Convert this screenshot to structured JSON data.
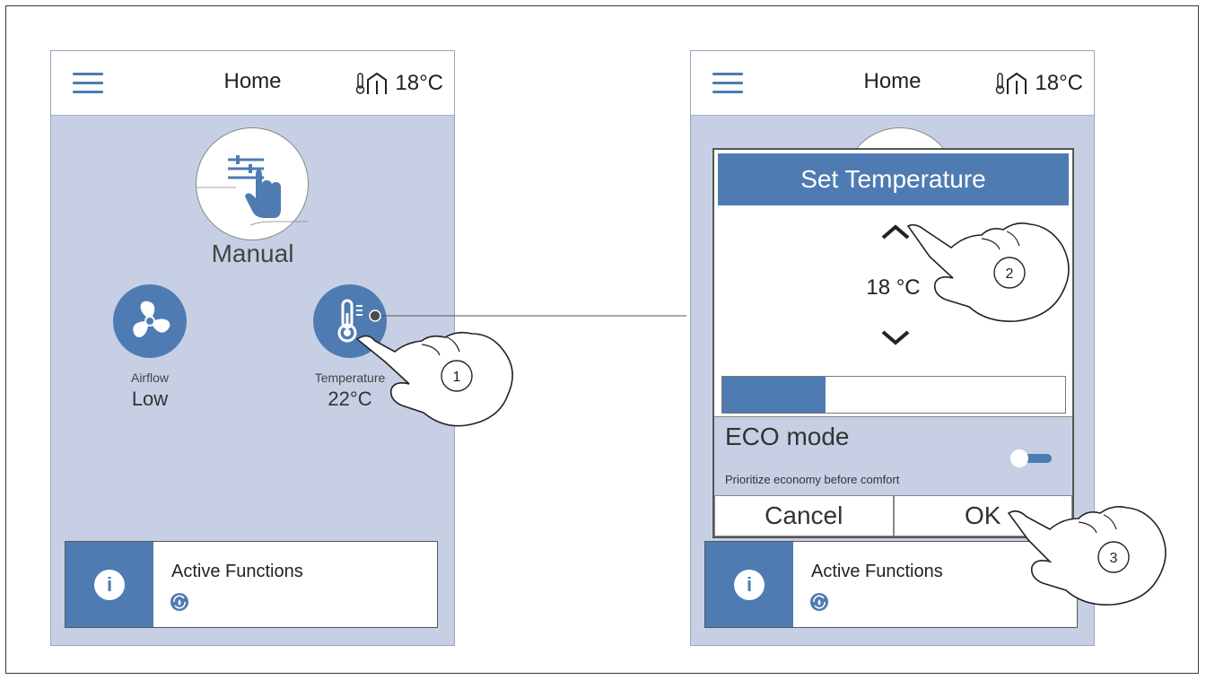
{
  "left_screen": {
    "header": {
      "title": "Home",
      "indoor_temp": "18°C"
    },
    "mode": {
      "label": "Manual"
    },
    "airflow": {
      "caption": "Airflow",
      "value": "Low"
    },
    "temperature": {
      "caption": "Temperature",
      "value": "22°C"
    },
    "active_functions": {
      "label": "Active Functions"
    }
  },
  "right_screen": {
    "header": {
      "title": "Home",
      "indoor_temp": "18°C"
    },
    "dialog": {
      "title": "Set Temperature",
      "value": "18 °C",
      "progress": 0.3,
      "eco": {
        "title": "ECO mode",
        "subtitle": "Prioritize economy before comfort",
        "enabled": true
      },
      "cancel_label": "Cancel",
      "ok_label": "OK"
    },
    "active_functions": {
      "label": "Active Functions"
    }
  },
  "callouts": [
    "1",
    "2",
    "3"
  ],
  "colors": {
    "accent": "#4f7bb3",
    "panel": "#c6cfe4"
  },
  "icons": [
    "menu-icon",
    "thermometer-house-icon",
    "manual-hand-icon",
    "fan-icon",
    "thermometer-icon",
    "info-icon",
    "active-function-icon",
    "chevron-up-icon",
    "chevron-down-icon",
    "pointing-hand-icon"
  ]
}
